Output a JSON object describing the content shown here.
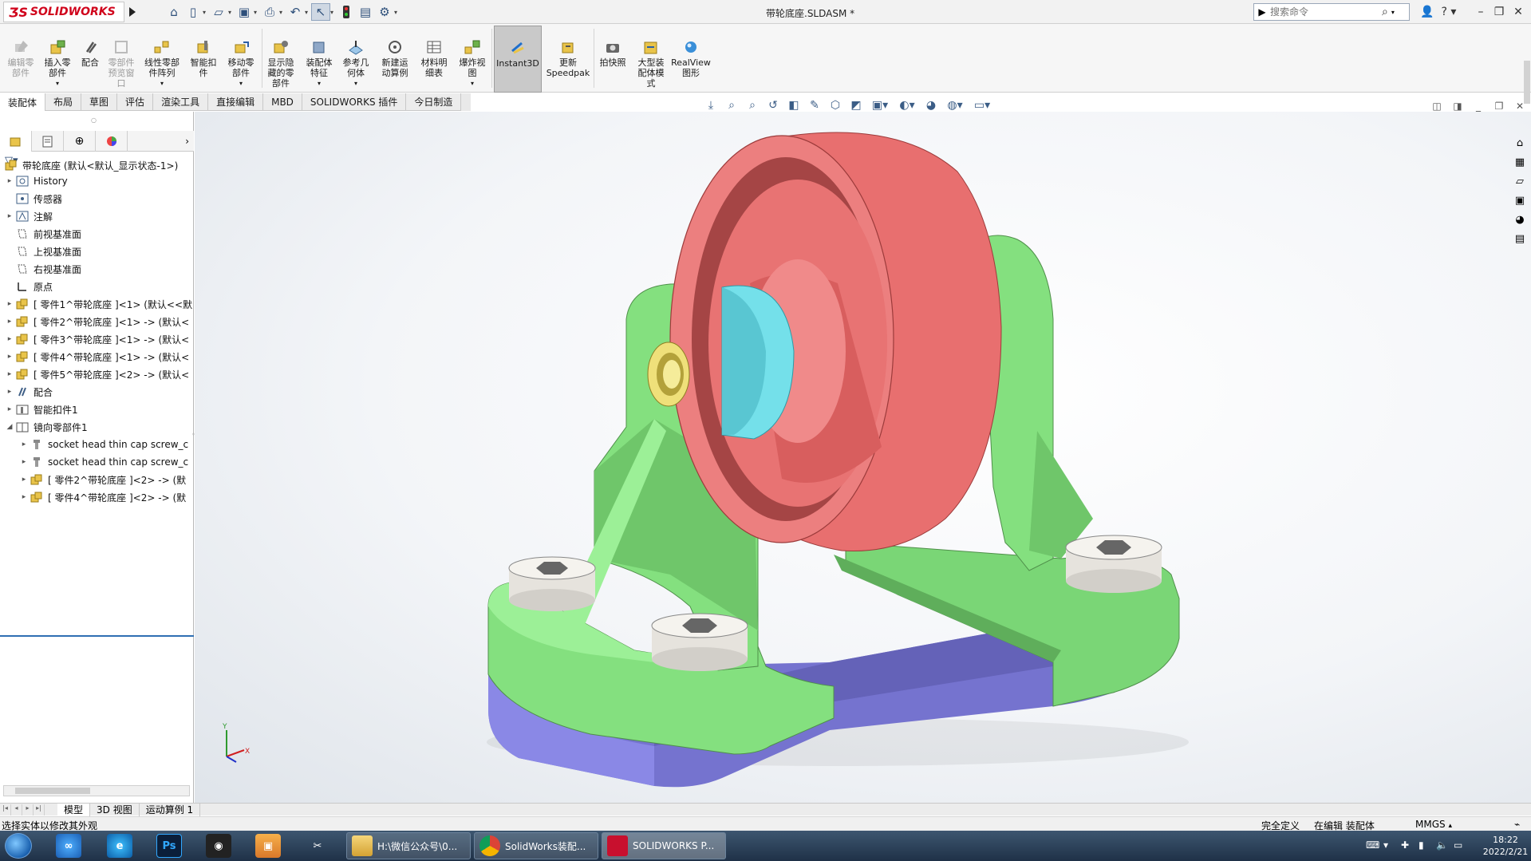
{
  "window": {
    "app_name": "SOLIDWORKS",
    "doc_title": "带轮底座.SLDASM *"
  },
  "search": {
    "placeholder": "搜索命令"
  },
  "ribbon": {
    "buttons": [
      {
        "label": "编辑零\n部件",
        "disabled": true
      },
      {
        "label": "插入零\n部件",
        "disabled": false
      },
      {
        "label": "配合",
        "disabled": false
      },
      {
        "label": "零部件\n预览窗\n口",
        "disabled": true
      },
      {
        "label": "线性零部\n件阵列",
        "disabled": false
      },
      {
        "label": "智能扣\n件",
        "disabled": false
      },
      {
        "label": "移动零\n部件",
        "disabled": false
      },
      {
        "label": "显示隐\n藏的零\n部件",
        "disabled": false
      },
      {
        "label": "装配体\n特征",
        "disabled": false
      },
      {
        "label": "参考几\n何体",
        "disabled": false
      },
      {
        "label": "新建运\n动算例",
        "disabled": false
      },
      {
        "label": "材料明\n细表",
        "disabled": false
      },
      {
        "label": "爆炸视\n图",
        "disabled": false
      },
      {
        "label": "Instant3D",
        "disabled": false
      },
      {
        "label": "更新\nSpeedpak",
        "disabled": false
      },
      {
        "label": "拍快照",
        "disabled": false
      },
      {
        "label": "大型装\n配体模\n式",
        "disabled": false
      },
      {
        "label": "RealView\n图形",
        "disabled": false
      }
    ]
  },
  "tabs": [
    "装配体",
    "布局",
    "草图",
    "评估",
    "渲染工具",
    "直接编辑",
    "MBD",
    "SOLIDWORKS 插件",
    "今日制造"
  ],
  "tree": {
    "root": "带轮底座  (默认<默认_显示状态-1>)",
    "items": [
      {
        "label": "History",
        "indent": 1,
        "expand": true
      },
      {
        "label": "传感器",
        "indent": 1,
        "expand": false
      },
      {
        "label": "注解",
        "indent": 1,
        "expand": true
      },
      {
        "label": "前视基准面",
        "indent": 1,
        "expand": false
      },
      {
        "label": "上视基准面",
        "indent": 1,
        "expand": false
      },
      {
        "label": "右视基准面",
        "indent": 1,
        "expand": false
      },
      {
        "label": "原点",
        "indent": 1,
        "expand": false
      },
      {
        "label": "[ 零件1^带轮底座 ]<1> (默认<<默",
        "indent": 1,
        "expand": true
      },
      {
        "label": "[ 零件2^带轮底座 ]<1> -> (默认<",
        "indent": 1,
        "expand": true
      },
      {
        "label": "[ 零件3^带轮底座 ]<1> -> (默认<",
        "indent": 1,
        "expand": true
      },
      {
        "label": "[ 零件4^带轮底座 ]<1> -> (默认<",
        "indent": 1,
        "expand": true
      },
      {
        "label": "[ 零件5^带轮底座 ]<2> -> (默认<",
        "indent": 1,
        "expand": true
      },
      {
        "label": "配合",
        "indent": 1,
        "expand": true
      },
      {
        "label": "智能扣件1",
        "indent": 1,
        "expand": true
      },
      {
        "label": "镜向零部件1",
        "indent": 1,
        "expand": "open"
      },
      {
        "label": "socket head thin cap screw_c",
        "indent": 2,
        "expand": true
      },
      {
        "label": "socket head thin cap screw_c",
        "indent": 2,
        "expand": true
      },
      {
        "label": "[ 零件2^带轮底座 ]<2> -> (默",
        "indent": 2,
        "expand": true
      },
      {
        "label": "[ 零件4^带轮底座 ]<2> -> (默",
        "indent": 2,
        "expand": true
      }
    ]
  },
  "bottom_tabs": [
    "模型",
    "3D 视图",
    "运动算例 1"
  ],
  "status": {
    "hint": "选择实体以修改其外观",
    "definition": "完全定义",
    "editing": "在编辑 装配体",
    "units": "MMGS"
  },
  "taskbar": {
    "apps": [
      {
        "label": "H:\\微信公众号\\0..."
      },
      {
        "label": "SolidWorks装配..."
      },
      {
        "label": "SOLIDWORKS P..."
      }
    ],
    "time": "18:22",
    "date": "2022/2/21"
  },
  "colors": {
    "wheel": "#e56f6f",
    "brackets": "#84e07f",
    "base": "#8280e0",
    "bushing": "#74e0ea",
    "washer": "#f0e27a"
  }
}
